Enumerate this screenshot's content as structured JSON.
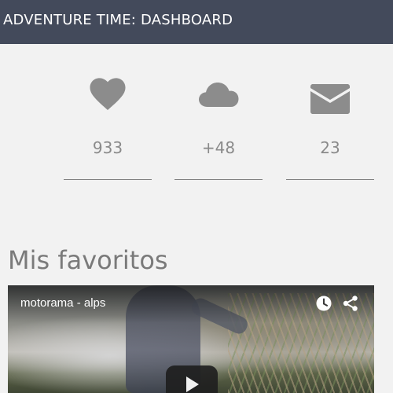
{
  "header": {
    "title": "ADVENTURE TIME: DASHBOARD"
  },
  "stats": [
    {
      "icon": "heart-icon",
      "value": "933"
    },
    {
      "icon": "cloud-icon",
      "value": "+48"
    },
    {
      "icon": "envelope-icon",
      "value": "23"
    }
  ],
  "favorites": {
    "title": "Mis favoritos",
    "video": {
      "title": "motorama - alps"
    }
  },
  "colors": {
    "header_bg": "#434a5b",
    "background": "#f2f2f2",
    "icon_gray": "#8c8c8c",
    "text_gray": "#8a8a8a"
  }
}
